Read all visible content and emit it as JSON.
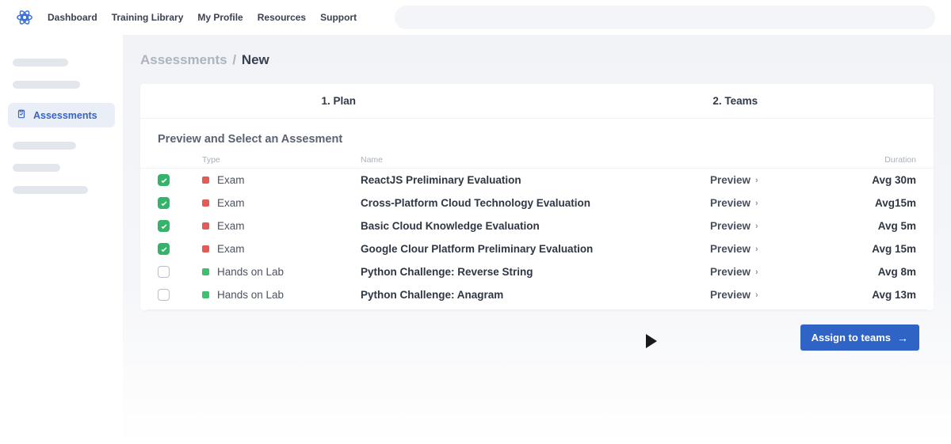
{
  "nav": {
    "items": [
      "Dashboard",
      "Training Library",
      "My Profile",
      "Resources",
      "Support"
    ]
  },
  "sidebar": {
    "active_label": "Assessments"
  },
  "breadcrumb": {
    "parent": "Assessments",
    "sep": "/",
    "current": "New"
  },
  "steps": {
    "step1": "1. Plan",
    "step2": "2. Teams"
  },
  "section": {
    "title": "Preview and Select an Assesment",
    "head_type": "Type",
    "head_name": "Name",
    "head_duration": "Duration"
  },
  "preview_label": "Preview",
  "rows": [
    {
      "checked": true,
      "type_color": "red",
      "type": "Exam",
      "name": "ReactJS Preliminary Evaluation",
      "preview": "Preview",
      "duration": "Avg 30m"
    },
    {
      "checked": true,
      "type_color": "red",
      "type": "Exam",
      "name": "Cross-Platform Cloud Technology Evaluation",
      "preview": "Preview",
      "duration": "Avg15m"
    },
    {
      "checked": true,
      "type_color": "red",
      "type": "Exam",
      "name": "Basic Cloud Knowledge Evaluation",
      "preview": "Preview",
      "duration": "Avg  5m"
    },
    {
      "checked": true,
      "type_color": "red",
      "type": "Exam",
      "name": "Google Clour Platform Preliminary Evaluation",
      "preview": "Preview",
      "duration": "Avg  15m"
    },
    {
      "checked": false,
      "type_color": "green",
      "type": "Hands on Lab",
      "name": "Python Challenge: Reverse String",
      "preview": "Preview",
      "duration": "Avg   8m"
    },
    {
      "checked": false,
      "type_color": "green",
      "type": "Hands on Lab",
      "name": "Python Challenge: Anagram",
      "preview": "Preview",
      "duration": "Avg  13m"
    }
  ],
  "actions": {
    "assign": "Assign to teams"
  },
  "colors": {
    "primary": "#2f63c6",
    "exam_dot": "#e25b56",
    "lab_dot": "#3fbf6f",
    "checked_bg": "#34b36a"
  }
}
